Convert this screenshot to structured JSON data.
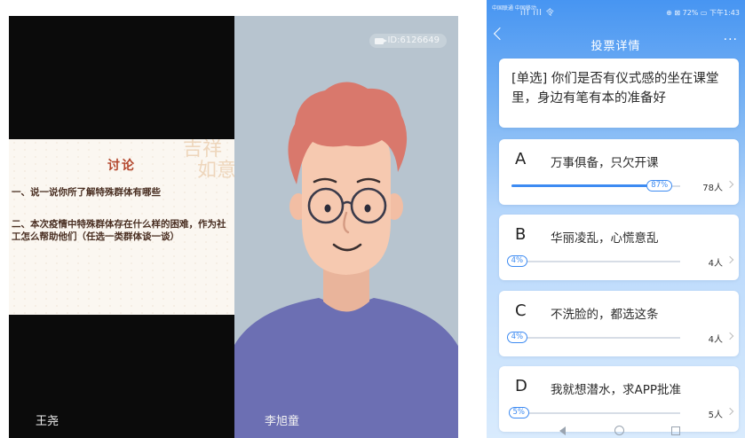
{
  "left_tile": {
    "slide": {
      "title": "讨论",
      "decoration_text": "吉祥如意",
      "line1": "一、说一说你所了解特殊群体有哪些",
      "line2": "二、本次疫情中特殊群体存在什么样的困难，作为社工怎么帮助他们（任选一类群体谈一谈）"
    },
    "participant_name": "王尧"
  },
  "mid_tile": {
    "room_id": "ID:6126649",
    "participant_name": "李旭童",
    "colors": {
      "background": "#b7c4cf",
      "hair": "#d9786c",
      "skin": "#f6c9b0",
      "shirt": "#6c6fb3"
    }
  },
  "phone": {
    "status_bar": {
      "carrier": "中国联通 中国移动",
      "signal": "ıll ıll 令",
      "right": "⊕ ⊠ 72% ▭ 下午1:43"
    },
    "title": "投票详情",
    "more_icon": "···",
    "question": "[单选] 你们是否有仪式感的坐在课堂里，身边有笔有本的准备好",
    "options": [
      {
        "letter": "A",
        "text": "万事俱备，只欠开课",
        "percent_label": "87%",
        "fraction": 0.87,
        "count": "78人"
      },
      {
        "letter": "B",
        "text": "华丽凌乱，心慌意乱",
        "percent_label": "4%",
        "fraction": 0.04,
        "count": "4人"
      },
      {
        "letter": "C",
        "text": "不洗脸的，都选这条",
        "percent_label": "4%",
        "fraction": 0.04,
        "count": "4人"
      },
      {
        "letter": "D",
        "text": "我就想潜水，求APP批准",
        "percent_label": "5%",
        "fraction": 0.05,
        "count": "5人"
      }
    ],
    "colors": {
      "accent": "#3d8bf2",
      "header": "#4795f2"
    }
  }
}
